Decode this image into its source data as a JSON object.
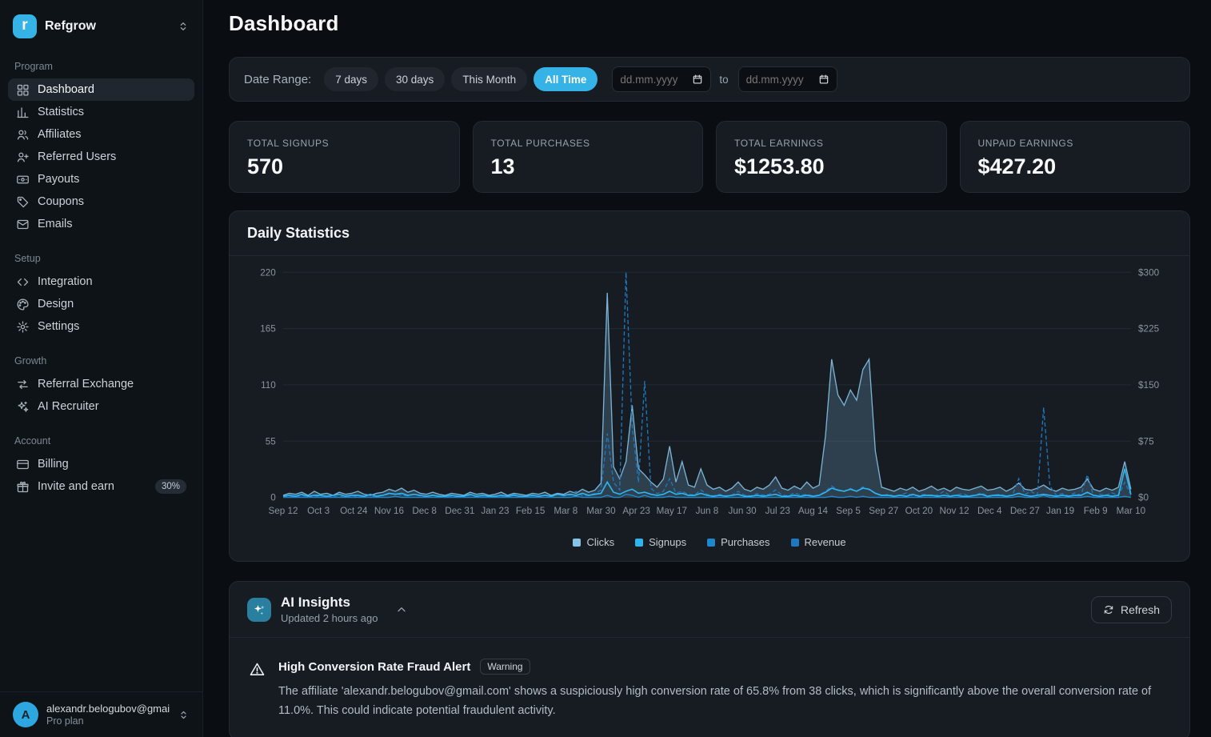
{
  "colors": {
    "accent": "#35b3e6",
    "sidebar_bg": "#0e1318",
    "main_bg": "#0a0e13",
    "card_bg": "#171c23"
  },
  "sidebar": {
    "brand": {
      "name": "Refgrow",
      "logo_letter": "r"
    },
    "sections": [
      {
        "label": "Program",
        "items": [
          {
            "label": "Dashboard",
            "icon": "dashboard-icon",
            "active": true
          },
          {
            "label": "Statistics",
            "icon": "statistics-icon"
          },
          {
            "label": "Affiliates",
            "icon": "users-icon"
          },
          {
            "label": "Referred Users",
            "icon": "user-plus-icon"
          },
          {
            "label": "Payouts",
            "icon": "banknote-icon"
          },
          {
            "label": "Coupons",
            "icon": "tag-icon"
          },
          {
            "label": "Emails",
            "icon": "mail-icon"
          }
        ]
      },
      {
        "label": "Setup",
        "items": [
          {
            "label": "Integration",
            "icon": "code-icon"
          },
          {
            "label": "Design",
            "icon": "palette-icon"
          },
          {
            "label": "Settings",
            "icon": "gear-icon"
          }
        ]
      },
      {
        "label": "Growth",
        "items": [
          {
            "label": "Referral Exchange",
            "icon": "swap-icon"
          },
          {
            "label": "AI Recruiter",
            "icon": "sparkles-icon"
          }
        ]
      },
      {
        "label": "Account",
        "items": [
          {
            "label": "Billing",
            "icon": "credit-card-icon"
          },
          {
            "label": "Invite and earn",
            "icon": "gift-icon",
            "badge": "30%"
          }
        ]
      }
    ],
    "user": {
      "email": "alexandr.belogubov@gmai...",
      "plan": "Pro plan",
      "avatar_initial": "A"
    }
  },
  "header": {
    "title": "Dashboard"
  },
  "date_range": {
    "label": "Date Range:",
    "presets": [
      "7 days",
      "30 days",
      "This Month",
      "All Time"
    ],
    "active_preset": "All Time",
    "from_placeholder": "dd.mm.yyyy",
    "to_placeholder": "dd.mm.yyyy",
    "separator": "to"
  },
  "stats": [
    {
      "label": "TOTAL SIGNUPS",
      "value": "570"
    },
    {
      "label": "TOTAL PURCHASES",
      "value": "13"
    },
    {
      "label": "TOTAL EARNINGS",
      "value": "$1253.80"
    },
    {
      "label": "UNPAID EARNINGS",
      "value": "$427.20"
    }
  ],
  "chart_data": {
    "type": "line",
    "title": "Daily Statistics",
    "x_ticks": [
      "Sep 12",
      "Oct 3",
      "Oct 24",
      "Nov 16",
      "Dec 8",
      "Dec 31",
      "Jan 23",
      "Feb 15",
      "Mar 8",
      "Mar 30",
      "Apr 23",
      "May 17",
      "Jun 8",
      "Jun 30",
      "Jul 23",
      "Aug 14",
      "Sep 5",
      "Sep 27",
      "Oct 20",
      "Nov 12",
      "Dec 4",
      "Dec 27",
      "Jan 19",
      "Feb 9",
      "Mar 10"
    ],
    "y_left_ticks": [
      "0",
      "55",
      "110",
      "165",
      "220"
    ],
    "y_right_ticks": [
      "$0",
      "$75",
      "$150",
      "$225",
      "$300"
    ],
    "y_left_max": 220,
    "y_right_max": 300,
    "grid": true,
    "legend_position": "bottom",
    "series": [
      {
        "name": "Clicks",
        "axis": "left",
        "color": "#85c3e8",
        "style": "solid",
        "values": [
          2,
          4,
          3,
          5,
          2,
          6,
          3,
          4,
          2,
          5,
          3,
          4,
          6,
          3,
          2,
          4,
          5,
          8,
          6,
          9,
          5,
          7,
          4,
          3,
          5,
          3,
          2,
          4,
          3,
          2,
          5,
          3,
          4,
          2,
          3,
          5,
          2,
          4,
          3,
          2,
          4,
          3,
          5,
          2,
          4,
          3,
          6,
          4,
          8,
          5,
          7,
          14,
          200,
          30,
          18,
          35,
          90,
          28,
          22,
          15,
          10,
          18,
          50,
          15,
          35,
          12,
          10,
          28,
          12,
          8,
          10,
          6,
          9,
          15,
          8,
          6,
          10,
          8,
          12,
          20,
          9,
          7,
          11,
          8,
          15,
          9,
          12,
          60,
          135,
          100,
          90,
          105,
          95,
          125,
          135,
          45,
          10,
          8,
          6,
          9,
          7,
          10,
          6,
          8,
          11,
          7,
          9,
          6,
          10,
          8,
          7,
          9,
          11,
          7,
          8,
          10,
          6,
          9,
          14,
          8,
          7,
          9,
          12,
          8,
          6,
          9,
          7,
          8,
          10,
          18,
          8,
          6,
          9,
          7,
          10,
          35,
          8
        ]
      },
      {
        "name": "Signups",
        "axis": "left",
        "color": "#2eb5f0",
        "style": "solid",
        "values": [
          1,
          2,
          1,
          3,
          1,
          2,
          2,
          1,
          2,
          3,
          1,
          2,
          2,
          1,
          3,
          1,
          2,
          4,
          3,
          4,
          2,
          3,
          2,
          1,
          2,
          1,
          1,
          2,
          1,
          1,
          3,
          1,
          2,
          1,
          1,
          2,
          1,
          2,
          1,
          1,
          2,
          1,
          2,
          1,
          3,
          2,
          3,
          2,
          4,
          2,
          3,
          4,
          15,
          5,
          3,
          6,
          8,
          4,
          5,
          3,
          2,
          3,
          6,
          3,
          4,
          2,
          2,
          4,
          2,
          1,
          2,
          1,
          2,
          3,
          1,
          1,
          2,
          1,
          2,
          3,
          1,
          1,
          2,
          1,
          2,
          1,
          2,
          5,
          9,
          7,
          6,
          8,
          6,
          9,
          8,
          4,
          2,
          2,
          1,
          2,
          1,
          3,
          1,
          2,
          2,
          1,
          2,
          1,
          2,
          1,
          1,
          2,
          3,
          1,
          2,
          2,
          1,
          2,
          4,
          2,
          1,
          2,
          3,
          2,
          1,
          2,
          1,
          2,
          2,
          5,
          2,
          1,
          2,
          1,
          2,
          28,
          3
        ]
      },
      {
        "name": "Purchases",
        "axis": "left",
        "color": "#1e88cf",
        "style": "solid",
        "values": [
          0,
          0,
          0,
          0,
          0,
          0,
          0,
          0,
          0,
          0,
          0,
          0,
          0,
          0,
          0,
          0,
          0,
          0,
          1,
          0,
          0,
          0,
          0,
          0,
          0,
          0,
          0,
          0,
          0,
          0,
          0,
          0,
          0,
          0,
          0,
          0,
          0,
          0,
          0,
          0,
          0,
          0,
          0,
          0,
          0,
          0,
          0,
          1,
          0,
          0,
          0,
          0,
          2,
          0,
          0,
          3,
          2,
          0,
          2,
          0,
          0,
          0,
          1,
          0,
          0,
          0,
          0,
          0,
          0,
          0,
          0,
          0,
          0,
          0,
          0,
          0,
          0,
          0,
          0,
          0,
          0,
          0,
          0,
          0,
          0,
          0,
          0,
          0,
          1,
          0,
          0,
          1,
          0,
          1,
          0,
          0,
          0,
          0,
          0,
          0,
          0,
          0,
          0,
          0,
          0,
          0,
          0,
          0,
          0,
          0,
          0,
          0,
          0,
          0,
          0,
          0,
          0,
          0,
          1,
          0,
          0,
          0,
          2,
          0,
          0,
          0,
          0,
          0,
          0,
          1,
          0,
          0,
          0,
          0,
          0,
          1,
          0
        ]
      },
      {
        "name": "Revenue",
        "axis": "right",
        "color": "#1c79c0",
        "style": "dashed",
        "values": [
          0,
          2,
          0,
          3,
          0,
          2,
          1,
          0,
          2,
          0,
          3,
          0,
          2,
          1,
          0,
          2,
          3,
          4,
          5,
          3,
          2,
          4,
          2,
          1,
          3,
          1,
          0,
          2,
          1,
          0,
          3,
          1,
          2,
          0,
          1,
          2,
          0,
          4,
          1,
          0,
          2,
          1,
          3,
          0,
          4,
          2,
          3,
          8,
          2,
          3,
          5,
          10,
          85,
          20,
          10,
          300,
          95,
          20,
          155,
          12,
          5,
          8,
          25,
          6,
          8,
          4,
          3,
          10,
          4,
          2,
          4,
          2,
          3,
          8,
          3,
          2,
          5,
          3,
          4,
          10,
          3,
          2,
          6,
          3,
          4,
          2,
          3,
          8,
          15,
          10,
          8,
          12,
          8,
          14,
          10,
          5,
          2,
          4,
          2,
          3,
          6,
          2,
          3,
          4,
          2,
          3,
          8,
          2,
          3,
          5,
          2,
          3,
          6,
          2,
          3,
          4,
          2,
          3,
          25,
          4,
          8,
          3,
          120,
          15,
          3,
          5,
          2,
          6,
          3,
          30,
          2,
          4,
          3,
          6,
          2,
          20,
          3
        ]
      }
    ]
  },
  "ai_insights": {
    "title": "AI Insights",
    "updated": "Updated 2 hours ago",
    "refresh_label": "Refresh",
    "alert": {
      "title": "High Conversion Rate Fraud Alert",
      "badge": "Warning",
      "body": "The affiliate 'alexandr.belogubov@gmail.com' shows a suspiciously high conversion rate of 65.8% from 38 clicks, which is significantly above the overall conversion rate of 11.0%. This could indicate potential fraudulent activity."
    }
  }
}
